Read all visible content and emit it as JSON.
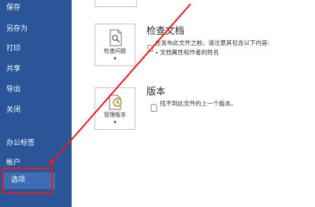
{
  "sidebar": {
    "items": [
      {
        "label": "保存"
      },
      {
        "label": "另存为"
      },
      {
        "label": "打印"
      },
      {
        "label": "共享"
      },
      {
        "label": "导出"
      },
      {
        "label": "关闭"
      },
      {
        "label": "办公标签"
      },
      {
        "label": "帐户"
      },
      {
        "label": "选项"
      }
    ]
  },
  "inspect": {
    "button_label": "检查问题",
    "title": "检查文档",
    "description": "在发布此文件之前，请注意其包含以下内容:",
    "bullet": "文档属性和作者的姓名"
  },
  "versions": {
    "button_label": "管理版本",
    "title": "版本",
    "description": "找不到此文件的上一个版本。"
  },
  "colors": {
    "sidebar": "#2a5699",
    "highlight": "#e21e1e",
    "arrow": "#e21e1e"
  },
  "icons": [
    "inspect-document-icon",
    "manage-versions-icon",
    "document-info-icon",
    "version-info-icon",
    "dropdown-caret-icon"
  ]
}
